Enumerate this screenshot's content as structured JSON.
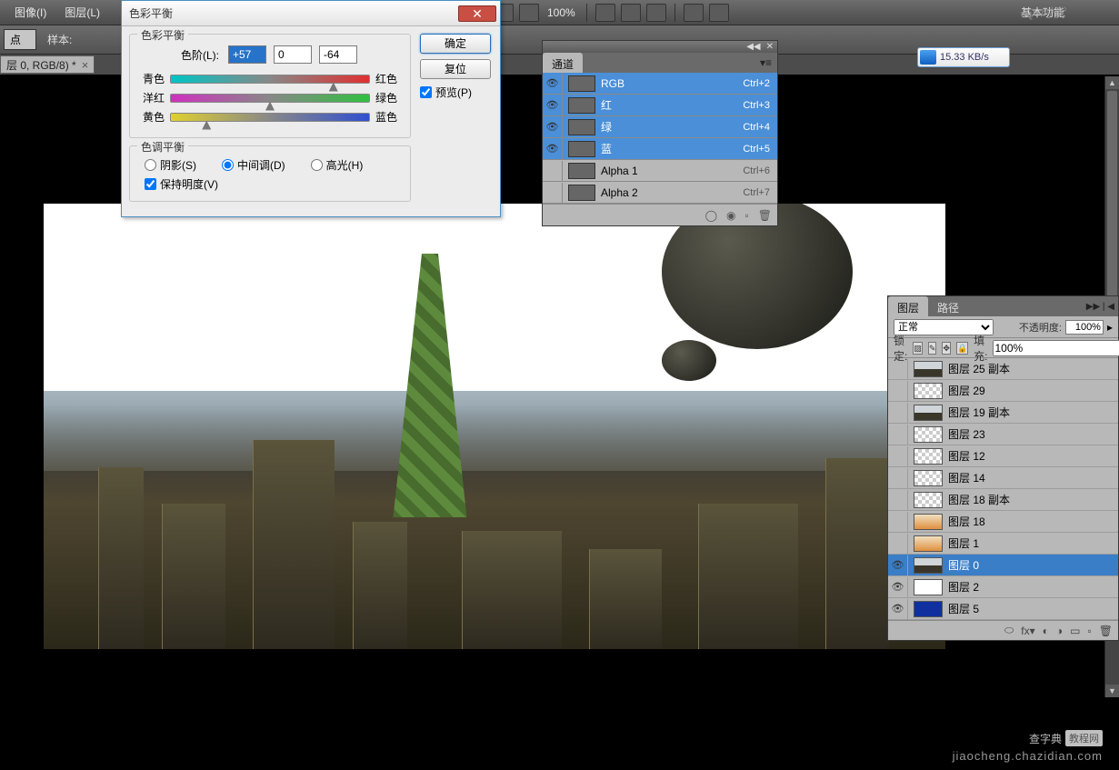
{
  "menu": {
    "image": "图像(I)",
    "layer": "图层(L)"
  },
  "toolbar": {
    "zoom": "100%",
    "right_label": "基本功能"
  },
  "options_bar": {
    "dropdown1": "点",
    "sample_label": "样本:"
  },
  "doc_tab": {
    "title": "层 0, RGB/8) *"
  },
  "dialog": {
    "title": "色彩平衡",
    "group1_title": "色彩平衡",
    "levels_label": "色阶(L):",
    "level_values": [
      "+57",
      "0",
      "-64"
    ],
    "sliders": [
      {
        "left": "青色",
        "right": "红色",
        "pos": 82
      },
      {
        "left": "洋红",
        "right": "绿色",
        "pos": 50
      },
      {
        "left": "黄色",
        "right": "蓝色",
        "pos": 18
      }
    ],
    "group2_title": "色调平衡",
    "tone_shadows": "阴影(S)",
    "tone_midtones": "中间调(D)",
    "tone_highlights": "高光(H)",
    "preserve_lum": "保持明度(V)",
    "btn_ok": "确定",
    "btn_reset": "复位",
    "preview": "预览(P)"
  },
  "channels": {
    "tab": "通道",
    "rows": [
      {
        "name": "RGB",
        "shortcut": "Ctrl+2",
        "selected": true,
        "eye": true
      },
      {
        "name": "红",
        "shortcut": "Ctrl+3",
        "selected": true,
        "eye": true
      },
      {
        "name": "绿",
        "shortcut": "Ctrl+4",
        "selected": true,
        "eye": true
      },
      {
        "name": "蓝",
        "shortcut": "Ctrl+5",
        "selected": true,
        "eye": true
      },
      {
        "name": "Alpha 1",
        "shortcut": "Ctrl+6",
        "selected": false,
        "eye": false
      },
      {
        "name": "Alpha 2",
        "shortcut": "Ctrl+7",
        "selected": false,
        "eye": false
      }
    ]
  },
  "layers": {
    "tab_layers": "图层",
    "tab_paths": "路径",
    "blend_mode": "正常",
    "opacity_label": "不透明度:",
    "opacity_value": "100%",
    "lock_label": "锁定:",
    "fill_label": "填充:",
    "fill_value": "100%",
    "rows": [
      {
        "name": "图层 25 副本",
        "eye": false,
        "type": "img"
      },
      {
        "name": "图层 29",
        "eye": false,
        "type": "trans"
      },
      {
        "name": "图层 19 副本",
        "eye": false,
        "type": "img"
      },
      {
        "name": "图层 23",
        "eye": false,
        "type": "trans"
      },
      {
        "name": "图层 12",
        "eye": false,
        "type": "trans"
      },
      {
        "name": "图层 14",
        "eye": false,
        "type": "trans"
      },
      {
        "name": "图层 18 副本",
        "eye": false,
        "type": "trans"
      },
      {
        "name": "图层 18",
        "eye": false,
        "type": "grad"
      },
      {
        "name": "图层 1",
        "eye": false,
        "type": "grad"
      },
      {
        "name": "图层 0",
        "eye": true,
        "type": "img",
        "selected": true
      },
      {
        "name": "图层 2",
        "eye": true,
        "type": "white"
      },
      {
        "name": "图层 5",
        "eye": true,
        "type": "blue"
      }
    ]
  },
  "net_speed": "15.33 KB/s",
  "watermark": {
    "main": "查字典",
    "sub": "教程网",
    "url": "jiaocheng.chazidian.com"
  }
}
